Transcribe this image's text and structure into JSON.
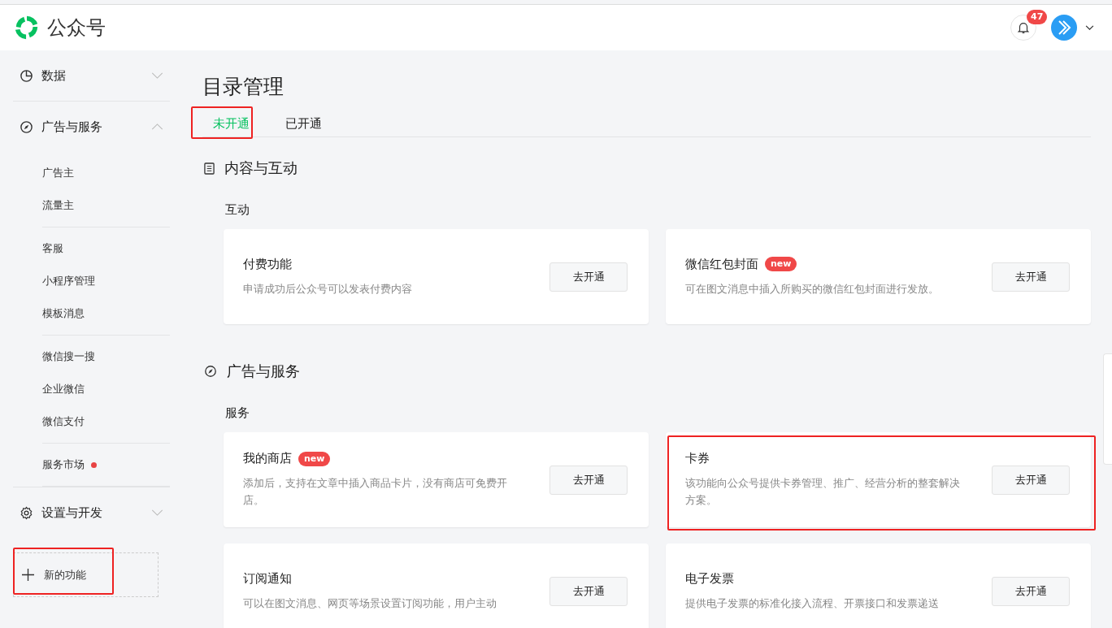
{
  "header": {
    "app_name": "公众号",
    "notifications": {
      "count": "47"
    }
  },
  "sidebar": {
    "groups": [
      {
        "label": "数据",
        "expanded": false
      },
      {
        "label": "广告与服务",
        "expanded": true,
        "sections": [
          [
            {
              "label": "广告主",
              "dot": false
            },
            {
              "label": "流量主",
              "dot": false
            }
          ],
          [
            {
              "label": "客服",
              "dot": false
            },
            {
              "label": "小程序管理",
              "dot": false
            },
            {
              "label": "模板消息",
              "dot": false
            }
          ],
          [
            {
              "label": "微信搜一搜",
              "dot": false
            },
            {
              "label": "企业微信",
              "dot": false
            },
            {
              "label": "微信支付",
              "dot": false
            }
          ],
          [
            {
              "label": "服务市场",
              "dot": true
            }
          ]
        ]
      },
      {
        "label": "设置与开发",
        "expanded": false
      }
    ],
    "new_feature": {
      "label": "新的功能",
      "highlighted": true
    }
  },
  "page": {
    "title": "目录管理",
    "tabs": [
      {
        "label": "未开通",
        "selected": true,
        "highlighted": true
      },
      {
        "label": "已开通",
        "selected": false,
        "highlighted": false
      }
    ],
    "sections": [
      {
        "title": "内容与互动",
        "subsections": [
          {
            "title": "互动",
            "cards": [
              {
                "title": "付费功能",
                "description": "申请成功后公众号可以发表付费内容",
                "button": "去开通",
                "highlighted": false
              },
              {
                "title": "微信红包封面",
                "badge": "new",
                "description": "可在图文消息中插入所购买的微信红包封面进行发放。",
                "button": "去开通",
                "highlighted": false
              }
            ]
          }
        ]
      },
      {
        "title": "广告与服务",
        "subsections": [
          {
            "title": "服务",
            "cards": [
              {
                "title": "我的商店",
                "badge": "new",
                "description": "添加后，支持在文章中插入商品卡片，没有商店可免费开店。",
                "button": "去开通",
                "highlighted": false
              },
              {
                "title": "卡券",
                "description": "该功能向公众号提供卡券管理、推广、经营分析的整套解决方案。",
                "button": "去开通",
                "highlighted": true
              },
              {
                "title": "订阅通知",
                "description": "可以在图文消息、网页等场景设置订阅功能，用户主动",
                "button": "去开通",
                "highlighted": false
              },
              {
                "title": "电子发票",
                "description": "提供电子发票的标准化接入流程、开票接口和发票递送",
                "button": "去开通",
                "highlighted": false
              }
            ]
          }
        ]
      }
    ]
  }
}
